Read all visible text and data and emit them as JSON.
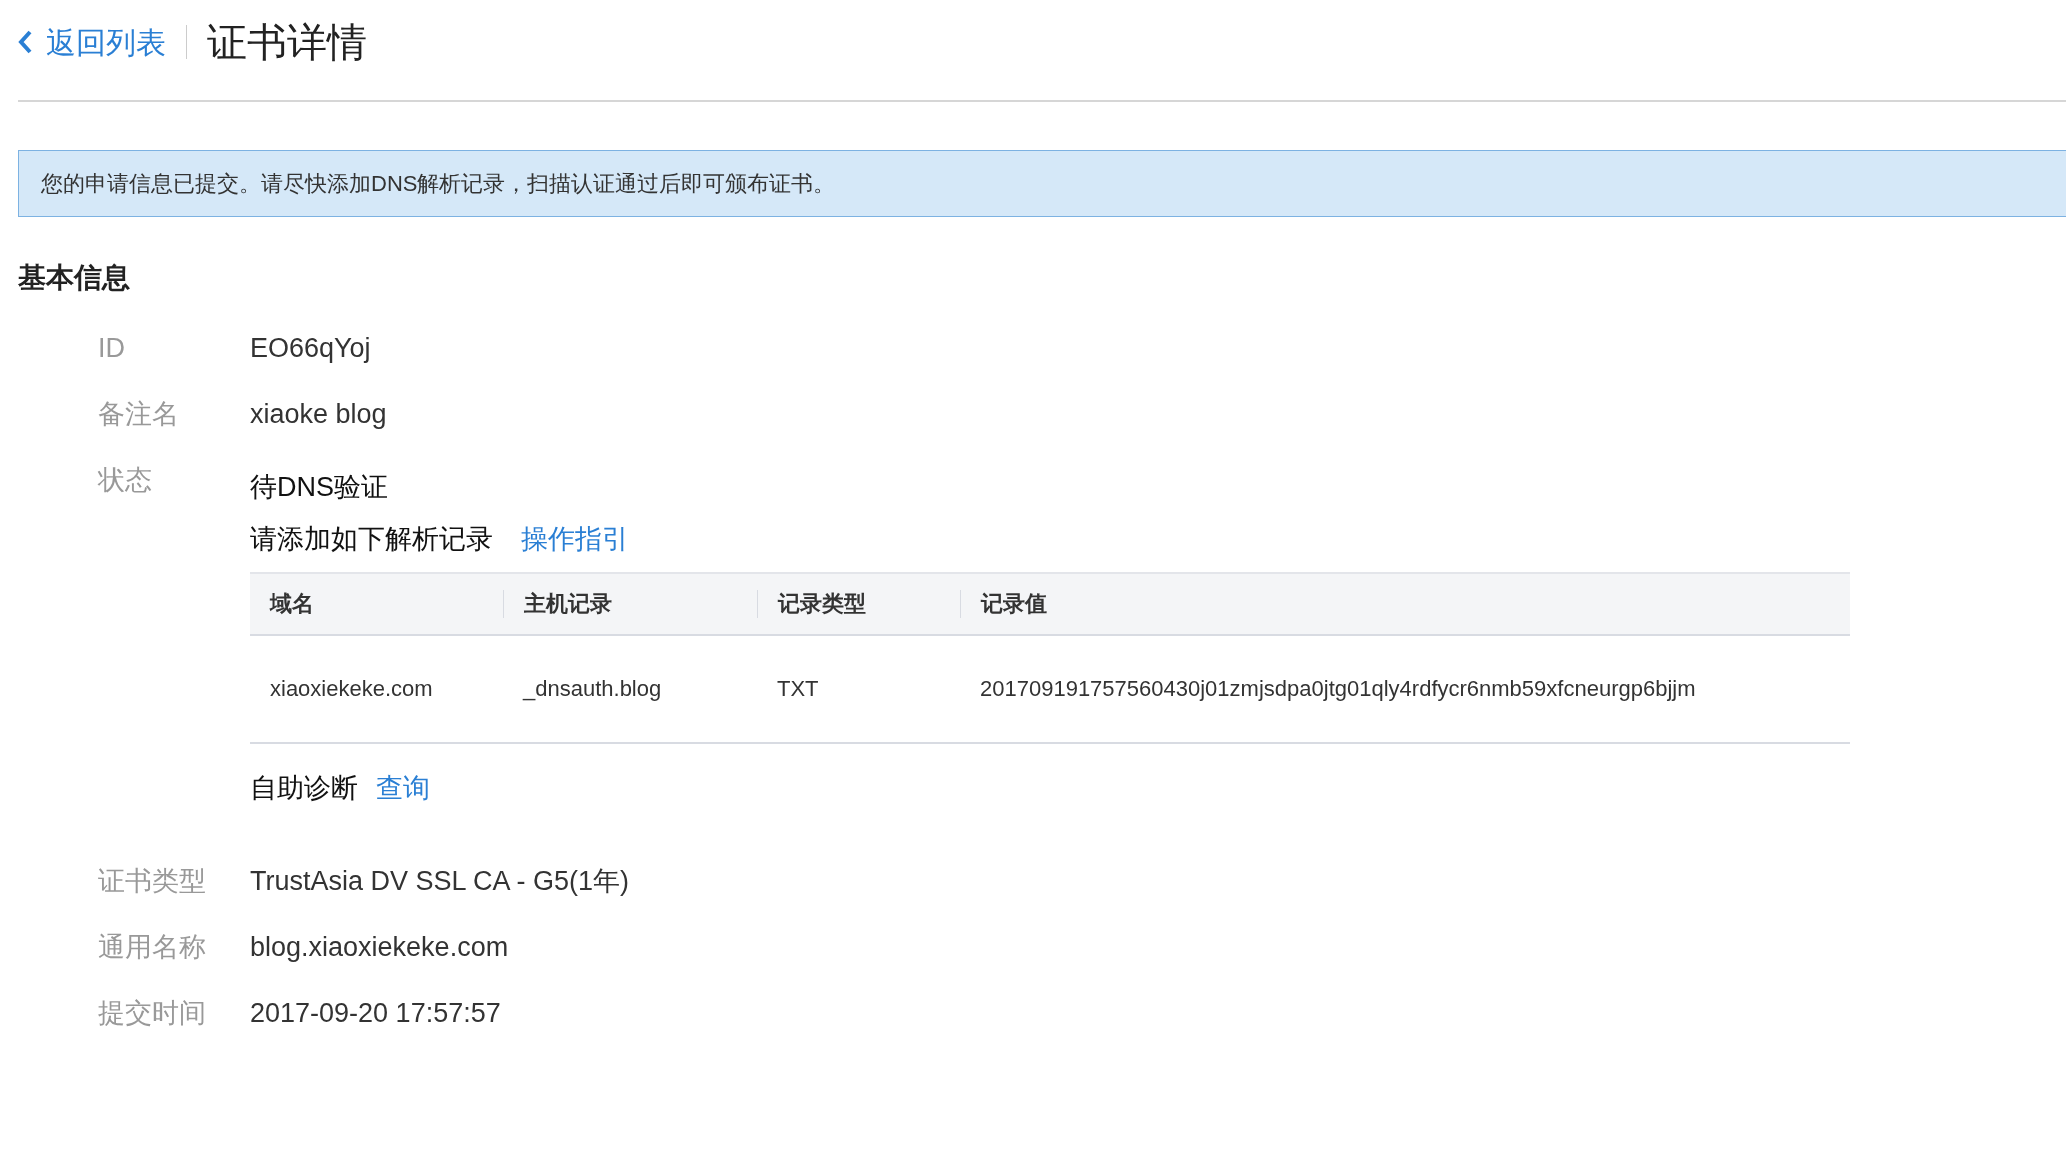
{
  "header": {
    "back_link": "返回列表",
    "title": "证书详情"
  },
  "notice": "您的申请信息已提交。请尽快添加DNS解析记录，扫描认证通过后即可颁布证书。",
  "section_title": "基本信息",
  "fields_top": [
    {
      "label": "ID",
      "value": "EO66qYoj"
    },
    {
      "label": "备注名",
      "value": "xiaoke blog"
    }
  ],
  "status": {
    "label": "状态",
    "value": "待DNS验证",
    "instruction": "请添加如下解析记录",
    "guide_link": "操作指引",
    "table": {
      "columns": [
        "域名",
        "主机记录",
        "记录类型",
        "记录值"
      ],
      "rows": [
        [
          "xiaoxiekeke.com",
          "_dnsauth.blog",
          "TXT",
          "201709191757560430j01zmjsdpa0jtg01qly4rdfycr6nmb59xfcneurgp6bjjm"
        ]
      ]
    },
    "diagnose_label": "自助诊断",
    "diagnose_link": "查询"
  },
  "fields_bottom": [
    {
      "label": "证书类型",
      "value": "TrustAsia DV SSL CA - G5(1年)"
    },
    {
      "label": "通用名称",
      "value": "blog.xiaoxiekeke.com"
    },
    {
      "label": "提交时间",
      "value": "2017-09-20 17:57:57"
    }
  ]
}
